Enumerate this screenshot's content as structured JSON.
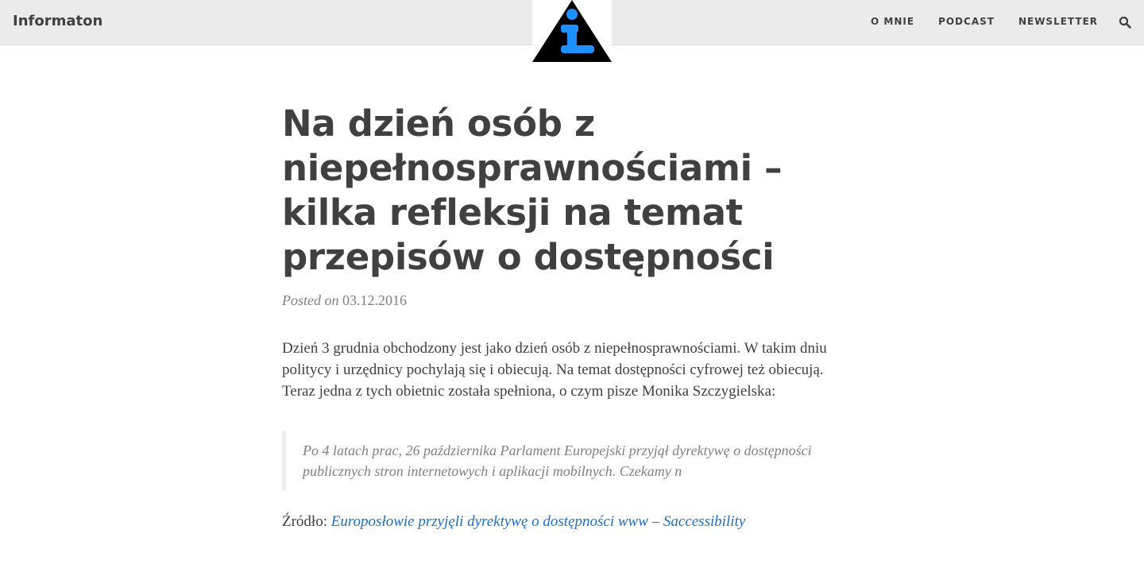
{
  "navbar": {
    "brand": "Informaton",
    "links": [
      "O MNIE",
      "PODCAST",
      "NEWSLETTER"
    ],
    "search_icon": "search-icon",
    "logo_icon": "info-triangle-icon",
    "logo_colors": {
      "triangle": "#000000",
      "letter": "#1e90ff"
    }
  },
  "post": {
    "title": "Na dzień osób z niepełnosprawnościami – kilka refleksji na temat przepisów o dostępności",
    "meta_prefix": "Posted on",
    "date": "03.12.2016",
    "paragraph": "Dzień 3 grudnia obchodzony jest jako dzień osób z niepełnosprawnościami. W takim dniu politycy i urzędnicy pochylają się i obiecują. Na temat dostępności cyfrowej też obiecują. Teraz jedna z tych obietnic została spełniona, o czym pisze Monika Szczygielska:",
    "quote": "Po 4 latach prac, 26 października Parlament Europejski przyjął dyrektywę o dostępności publicznych stron internetowych i aplikacji mobilnych. Czekamy n",
    "source_label": "Źródło:",
    "source_link": "Europosłowie przyjęli dyrektywę o dostępności www – Saccessibility"
  }
}
